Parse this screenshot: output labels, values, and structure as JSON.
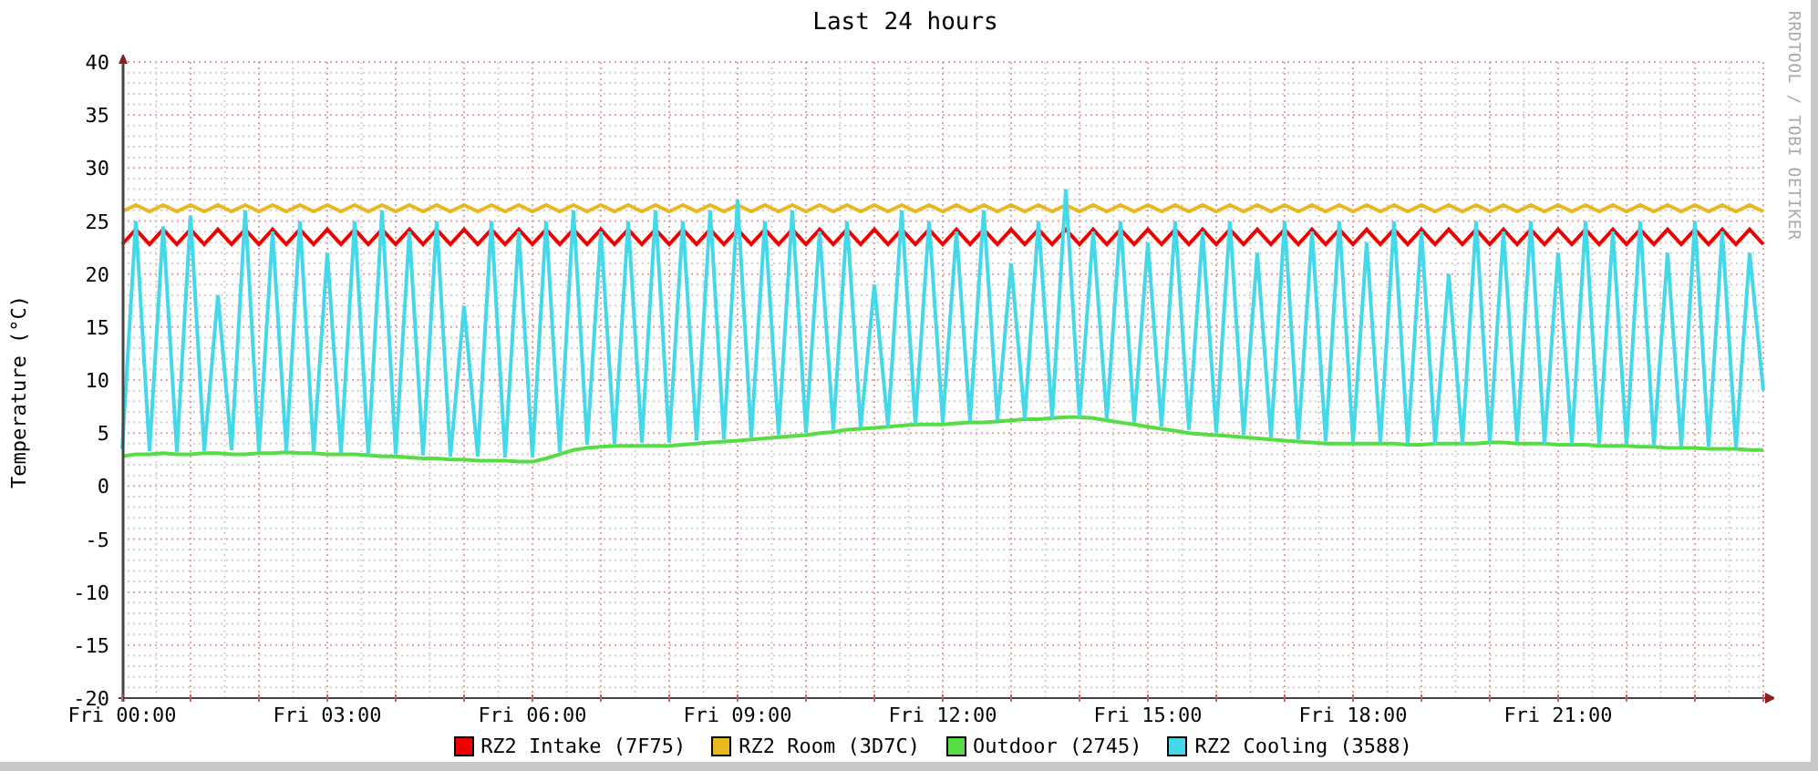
{
  "credit": "RRDTOOL / TOBI OETIKER",
  "chart_data": {
    "type": "line",
    "title": "Last 24 hours",
    "ylabel": "Temperature (°C)",
    "categories": [
      "Fri 00:00",
      null,
      null,
      null,
      null,
      null,
      null,
      null,
      null,
      null,
      null,
      null,
      null,
      null,
      null,
      "Fri 03:00",
      null,
      null,
      null,
      null,
      null,
      null,
      null,
      null,
      null,
      null,
      null,
      null,
      null,
      null,
      "Fri 06:00",
      null,
      null,
      null,
      null,
      null,
      null,
      null,
      null,
      null,
      null,
      null,
      null,
      null,
      null,
      "Fri 09:00",
      null,
      null,
      null,
      null,
      null,
      null,
      null,
      null,
      null,
      null,
      null,
      null,
      null,
      null,
      "Fri 12:00",
      null,
      null,
      null,
      null,
      null,
      null,
      null,
      null,
      null,
      null,
      null,
      null,
      null,
      null,
      "Fri 15:00",
      null,
      null,
      null,
      null,
      null,
      null,
      null,
      null,
      null,
      null,
      null,
      null,
      null,
      null,
      "Fri 18:00",
      null,
      null,
      null,
      null,
      null,
      null,
      null,
      null,
      null,
      null,
      null,
      null,
      null,
      null,
      "Fri 21:00",
      null,
      null,
      null,
      null,
      null,
      null,
      null,
      null,
      null,
      null,
      null,
      null,
      null,
      null,
      null
    ],
    "ylim": [
      -20,
      40
    ],
    "grid": true,
    "yticks": [
      -20,
      -15,
      -10,
      -5,
      0,
      5,
      10,
      15,
      20,
      25,
      30,
      35,
      40
    ],
    "series": [
      {
        "name": "RZ2 Intake (7F75)",
        "color": "#ee0000",
        "values": [
          22.8,
          24.2,
          22.8,
          24.2,
          22.8,
          24.2,
          22.8,
          24.2,
          22.8,
          24.2,
          22.8,
          24.2,
          22.8,
          24.2,
          22.8,
          24.2,
          22.8,
          24.2,
          22.8,
          24.2,
          22.8,
          24.2,
          22.8,
          24.2,
          22.8,
          24.2,
          22.8,
          24.2,
          22.8,
          24.2,
          22.8,
          24.2,
          22.8,
          24.2,
          22.8,
          24.2,
          22.8,
          24.2,
          22.8,
          24.2,
          22.8,
          24.2,
          22.8,
          24.2,
          22.8,
          24.2,
          22.8,
          24.2,
          22.8,
          24.2,
          22.8,
          24.2,
          22.8,
          24.2,
          22.8,
          24.2,
          22.8,
          24.2,
          22.8,
          24.2,
          22.8,
          24.2,
          22.8,
          24.2,
          22.8,
          24.2,
          22.8,
          24.2,
          22.8,
          24.2,
          22.8,
          24.2,
          22.8,
          24.2,
          22.8,
          24.2,
          22.8,
          24.2,
          22.8,
          24.2,
          22.8,
          24.2,
          22.8,
          24.2,
          22.8,
          24.2,
          22.8,
          24.2,
          22.8,
          24.2,
          22.8,
          24.2,
          22.8,
          24.2,
          22.8,
          24.2,
          22.8,
          24.2,
          22.8,
          24.2,
          22.8,
          24.2,
          22.8,
          24.2,
          22.8,
          24.2,
          22.8,
          24.2,
          22.8,
          24.2,
          22.8,
          24.2,
          22.8,
          24.2,
          22.8,
          24.2,
          22.8,
          24.2,
          22.8,
          24.2,
          22.8
        ]
      },
      {
        "name": "RZ2 Room (3D7C)",
        "color": "#e8b820",
        "values": [
          25.9,
          26.5,
          25.9,
          26.5,
          25.9,
          26.5,
          25.9,
          26.5,
          25.9,
          26.5,
          25.9,
          26.5,
          25.9,
          26.5,
          25.9,
          26.5,
          25.9,
          26.5,
          25.9,
          26.5,
          25.9,
          26.5,
          25.9,
          26.5,
          25.9,
          26.5,
          25.9,
          26.5,
          25.9,
          26.5,
          25.9,
          26.5,
          25.9,
          26.5,
          25.9,
          26.5,
          25.9,
          26.5,
          25.9,
          26.5,
          25.9,
          26.5,
          25.9,
          26.5,
          25.9,
          26.5,
          25.9,
          26.5,
          25.9,
          26.5,
          25.9,
          26.5,
          25.9,
          26.5,
          25.9,
          26.5,
          25.9,
          26.5,
          25.9,
          26.5,
          25.9,
          26.5,
          25.9,
          26.5,
          25.9,
          26.5,
          25.9,
          26.5,
          25.9,
          26.5,
          25.9,
          26.5,
          25.9,
          26.5,
          25.9,
          26.5,
          25.9,
          26.5,
          25.9,
          26.5,
          25.9,
          26.5,
          25.9,
          26.5,
          25.9,
          26.5,
          25.9,
          26.5,
          25.9,
          26.5,
          25.9,
          26.5,
          25.9,
          26.5,
          25.9,
          26.5,
          25.9,
          26.5,
          25.9,
          26.5,
          25.9,
          26.5,
          25.9,
          26.5,
          25.9,
          26.5,
          25.9,
          26.5,
          25.9,
          26.5,
          25.9,
          26.5,
          25.9,
          26.5,
          25.9,
          26.5,
          25.9,
          26.5,
          25.9,
          26.5,
          25.9
        ]
      },
      {
        "name": "Outdoor (2745)",
        "color": "#55dd44",
        "values": [
          2.8,
          3.0,
          3.0,
          3.1,
          3.0,
          3.0,
          3.1,
          3.1,
          3.0,
          3.0,
          3.1,
          3.1,
          3.2,
          3.1,
          3.1,
          3.0,
          3.0,
          3.0,
          2.9,
          2.8,
          2.8,
          2.7,
          2.6,
          2.6,
          2.5,
          2.5,
          2.4,
          2.4,
          2.4,
          2.3,
          2.3,
          2.6,
          3.0,
          3.4,
          3.6,
          3.7,
          3.8,
          3.8,
          3.8,
          3.8,
          3.8,
          3.9,
          4.0,
          4.1,
          4.2,
          4.3,
          4.4,
          4.5,
          4.6,
          4.7,
          4.8,
          5.0,
          5.1,
          5.3,
          5.4,
          5.5,
          5.6,
          5.7,
          5.8,
          5.8,
          5.8,
          5.9,
          6.0,
          6.0,
          6.1,
          6.2,
          6.3,
          6.3,
          6.4,
          6.5,
          6.5,
          6.4,
          6.2,
          6.0,
          5.8,
          5.6,
          5.4,
          5.2,
          5.0,
          4.9,
          4.8,
          4.7,
          4.6,
          4.5,
          4.4,
          4.3,
          4.2,
          4.1,
          4.0,
          4.0,
          4.0,
          4.0,
          4.0,
          4.0,
          3.9,
          3.9,
          4.0,
          4.0,
          4.0,
          4.0,
          4.1,
          4.1,
          4.0,
          4.0,
          4.0,
          3.9,
          3.9,
          3.9,
          3.8,
          3.8,
          3.8,
          3.7,
          3.7,
          3.6,
          3.6,
          3.6,
          3.5,
          3.5,
          3.5,
          3.4,
          3.4
        ]
      },
      {
        "name": "RZ2 Cooling (3588)",
        "color": "#44d8e8",
        "values": [
          3.5,
          25,
          3.3,
          24.5,
          3.2,
          25.5,
          3.3,
          18,
          3.4,
          26,
          3.2,
          24,
          3.3,
          25,
          3.2,
          22,
          3.1,
          25,
          3.0,
          26,
          3.0,
          24,
          2.9,
          25,
          2.8,
          17,
          2.8,
          25,
          2.7,
          24,
          2.7,
          25,
          3.2,
          26,
          3.9,
          24,
          4.0,
          25,
          4.1,
          26,
          4.1,
          25,
          4.3,
          26,
          4.4,
          27,
          4.6,
          25,
          4.8,
          26,
          5.0,
          24,
          5.3,
          25,
          5.5,
          19,
          5.6,
          26,
          5.8,
          25,
          6.0,
          24,
          6.1,
          26,
          6.2,
          21,
          6.3,
          25,
          6.4,
          28,
          6.5,
          24,
          6.3,
          25,
          6.0,
          23,
          5.6,
          25,
          5.3,
          24,
          5.0,
          25,
          4.8,
          22,
          4.6,
          25,
          4.4,
          24,
          4.2,
          25,
          4.1,
          23,
          4.1,
          25,
          4.0,
          24,
          4.0,
          20,
          4.0,
          25,
          4.1,
          24,
          4.1,
          25,
          4.0,
          22,
          4.0,
          25,
          4.0,
          24,
          3.9,
          25,
          3.8,
          22,
          3.7,
          25,
          3.7,
          24,
          3.6,
          22,
          9
        ]
      }
    ]
  }
}
